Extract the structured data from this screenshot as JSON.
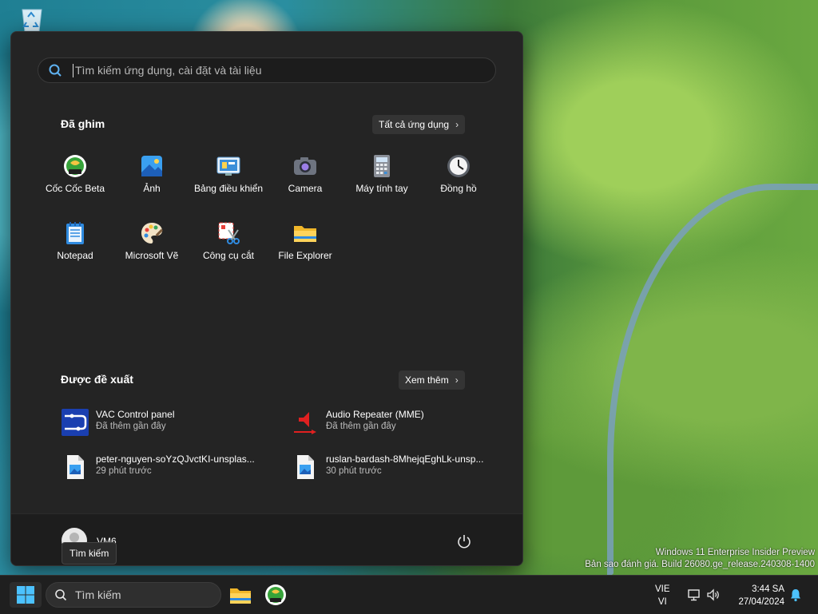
{
  "desktop": {
    "recycle_bin_icon": "recycle-bin-icon"
  },
  "start_menu": {
    "search_placeholder": "Tìm kiếm ứng dụng, cài đặt và tài liệu",
    "pinned": {
      "title": "Đã ghim",
      "all_apps_label": "Tất cả ứng dụng",
      "apps": [
        {
          "label": "Cốc Cốc Beta",
          "icon": "coccoc-beta-icon"
        },
        {
          "label": "Ảnh",
          "icon": "photos-icon"
        },
        {
          "label": "Bảng điều khiển",
          "icon": "control-panel-icon"
        },
        {
          "label": "Camera",
          "icon": "camera-icon"
        },
        {
          "label": "Máy tính tay",
          "icon": "calculator-icon"
        },
        {
          "label": "Đồng hồ",
          "icon": "clock-icon"
        },
        {
          "label": "Notepad",
          "icon": "notepad-icon"
        },
        {
          "label": "Microsoft Vẽ",
          "icon": "paint-icon"
        },
        {
          "label": "Công cụ cắt",
          "icon": "snipping-tool-icon"
        },
        {
          "label": "File Explorer",
          "icon": "folder-icon"
        }
      ]
    },
    "recommended": {
      "title": "Được đề xuất",
      "more_label": "Xem thêm",
      "items": [
        {
          "name": "VAC Control panel",
          "sub": "Đã thêm gần đây",
          "icon": "vac-control-icon"
        },
        {
          "name": "Audio Repeater (MME)",
          "sub": "Đã thêm gần đây",
          "icon": "audio-repeater-icon"
        },
        {
          "name": "peter-nguyen-soYzQJvctKI-unsplas...",
          "sub": "29 phút trước",
          "icon": "image-file-icon"
        },
        {
          "name": "ruslan-bardash-8MhejqEghLk-unsp...",
          "sub": "30 phút trước",
          "icon": "image-file-icon"
        }
      ]
    },
    "user": {
      "name": "VM6"
    },
    "power_icon": "power-icon"
  },
  "tooltip": "Tìm kiếm",
  "watermark": {
    "line1": "Windows 11 Enterprise Insider Preview",
    "line2": "Bản sao đánh giá. Build 26080.ge_release.240308-1400"
  },
  "taskbar": {
    "search_label": "Tìm kiếm",
    "pinned": [
      "folder-icon",
      "coccoc-beta-icon"
    ],
    "language": {
      "top": "VIE",
      "bottom": "VI"
    },
    "time": "3:44 SA",
    "date": "27/04/2024"
  },
  "colors": {
    "accent": "#0078d4",
    "menu_bg": "#242424",
    "taskbar_bg": "#1f1f1f"
  }
}
